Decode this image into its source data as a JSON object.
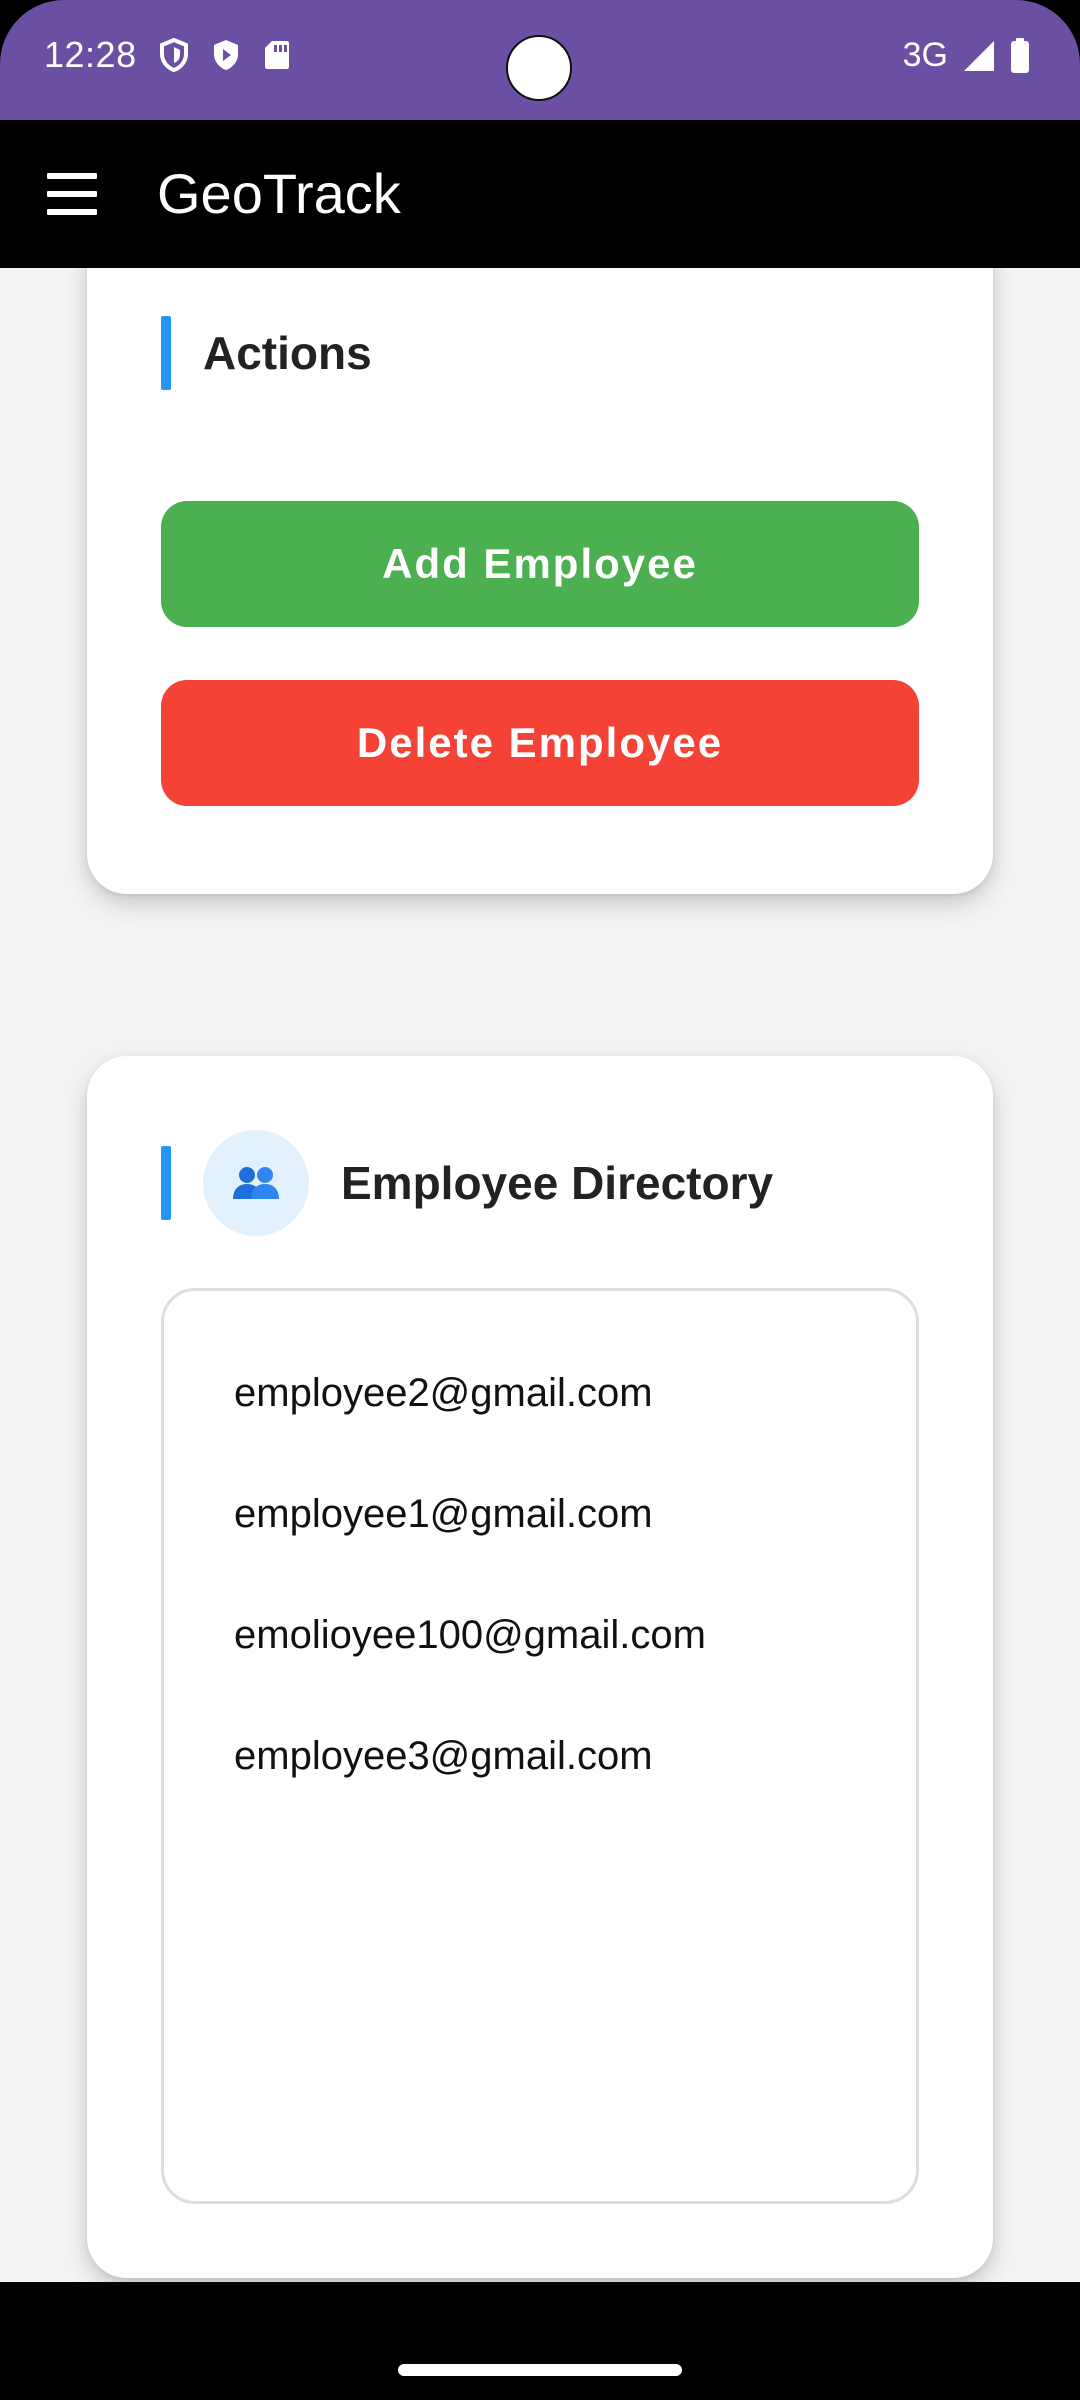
{
  "status_bar": {
    "time": "12:28",
    "network": "3G",
    "color": "#6A4FA3",
    "icons": [
      "shield-icon",
      "play-protect-icon",
      "sd-card-icon",
      "signal-icon",
      "battery-icon"
    ]
  },
  "app_bar": {
    "title": "GeoTrack",
    "menu_icon": "hamburger-menu-icon"
  },
  "actions_card": {
    "title": "Actions",
    "add_button_label": "Add Employee",
    "delete_button_label": "Delete Employee",
    "add_color": "#4CAF50",
    "delete_color": "#F44336",
    "accent_color": "#2196F3"
  },
  "directory_card": {
    "title": "Employee Directory",
    "icon": "people-icon",
    "employees": [
      "employee2@gmail.com",
      "employee1@gmail.com",
      "emolioyee100@gmail.com",
      "employee3@gmail.com"
    ]
  }
}
